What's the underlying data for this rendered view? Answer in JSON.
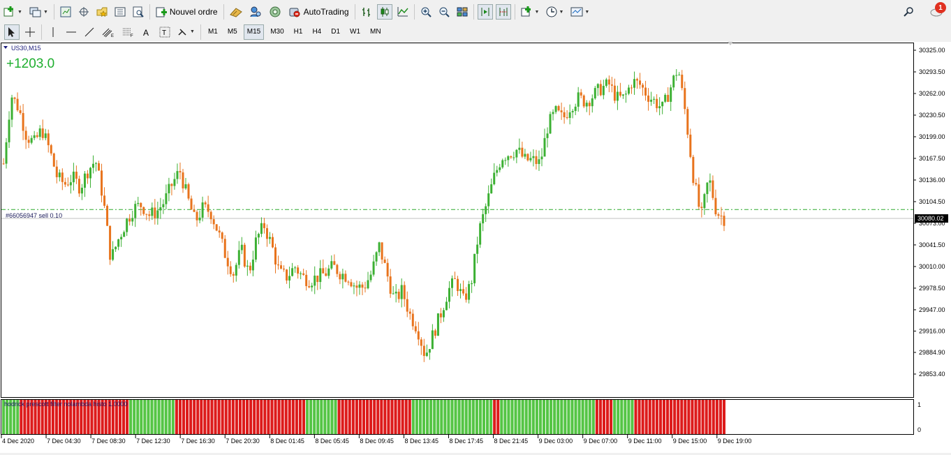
{
  "toolbar": {
    "new_order_label": "Nouvel ordre",
    "autotrading_label": "AutoTrading",
    "notification_count": "1"
  },
  "timeframes": [
    "M1",
    "M5",
    "M15",
    "M30",
    "H1",
    "H4",
    "D1",
    "W1",
    "MN"
  ],
  "active_timeframe": "M15",
  "chart": {
    "symbol_label": "US30,M15",
    "profit_text": "+1203.0",
    "order_line_label": "#66056947 sell 0.10",
    "current_price_label": "30080.02",
    "indicator_label": "hodrick prescott filter nolambda histo 1.0000"
  },
  "colors": {
    "bull": "#3cb033",
    "bear": "#e8731c",
    "order_line": "#2eaa2e",
    "hist_red": "#dd1b1b",
    "hist_green": "#55c545",
    "profit": "#1fae2f"
  },
  "chart_data": {
    "type": "candlestick",
    "symbol": "US30",
    "timeframe": "M15",
    "price_ticks": [
      "30325.00",
      "30293.50",
      "30262.00",
      "30230.50",
      "30199.00",
      "30167.50",
      "30136.00",
      "30104.50",
      "30073.00",
      "30041.50",
      "30010.00",
      "29978.50",
      "29947.00",
      "29916.00",
      "29884.90",
      "29853.40"
    ],
    "ylim": [
      29853.4,
      30325.0
    ],
    "current_price": 30080.02,
    "order_price": 30093,
    "time_labels": [
      "4 Dec 2020",
      "7 Dec 04:30",
      "7 Dec 08:30",
      "7 Dec 12:30",
      "7 Dec 16:30",
      "7 Dec 20:30",
      "8 Dec 01:45",
      "8 Dec 05:45",
      "8 Dec 09:45",
      "8 Dec 13:45",
      "8 Dec 17:45",
      "8 Dec 21:45",
      "9 Dec 03:00",
      "9 Dec 07:00",
      "9 Dec 11:00",
      "9 Dec 15:00",
      "9 Dec 19:00"
    ],
    "close_path": [
      30160,
      30260,
      30240,
      30200,
      30190,
      30210,
      30180,
      30140,
      30130,
      30140,
      30125,
      30150,
      30165,
      30110,
      30020,
      30050,
      30075,
      30095,
      30100,
      30085,
      30090,
      30105,
      30130,
      30150,
      30110,
      30075,
      30095,
      30090,
      30060,
      30025,
      30000,
      30035,
      30000,
      30050,
      30070,
      30040,
      30000,
      29995,
      30010,
      29995,
      29990,
      29995,
      30000,
      30010,
      30000,
      29995,
      29980,
      29980,
      30000,
      30040,
      30000,
      29960,
      29975,
      29940,
      29920,
      29880,
      29910,
      29940,
      29975,
      29990,
      29960,
      29985,
      30060,
      30100,
      30140,
      30170,
      30175,
      30180,
      30165,
      30165,
      30160,
      30215,
      30235,
      30225,
      30245,
      30255,
      30250,
      30260,
      30270,
      30275,
      30255,
      30255,
      30280,
      30275,
      30260,
      30250,
      30240,
      30270,
      30300,
      30230,
      30140,
      30080,
      30140,
      30090,
      30080
    ],
    "histogram": {
      "ylim": [
        0,
        1
      ],
      "y_ticks": [
        "1",
        "0"
      ],
      "segments": [
        {
          "color": "green",
          "bars": 5
        },
        {
          "color": "red",
          "bars": 31
        },
        {
          "color": "green",
          "bars": 13
        },
        {
          "color": "red",
          "bars": 37
        },
        {
          "color": "green",
          "bars": 9
        },
        {
          "color": "red",
          "bars": 21
        },
        {
          "color": "green",
          "bars": 23
        },
        {
          "color": "red",
          "bars": 2
        },
        {
          "color": "green",
          "bars": 27
        },
        {
          "color": "red",
          "bars": 5
        },
        {
          "color": "green",
          "bars": 6
        },
        {
          "color": "red",
          "bars": 26
        }
      ]
    }
  }
}
